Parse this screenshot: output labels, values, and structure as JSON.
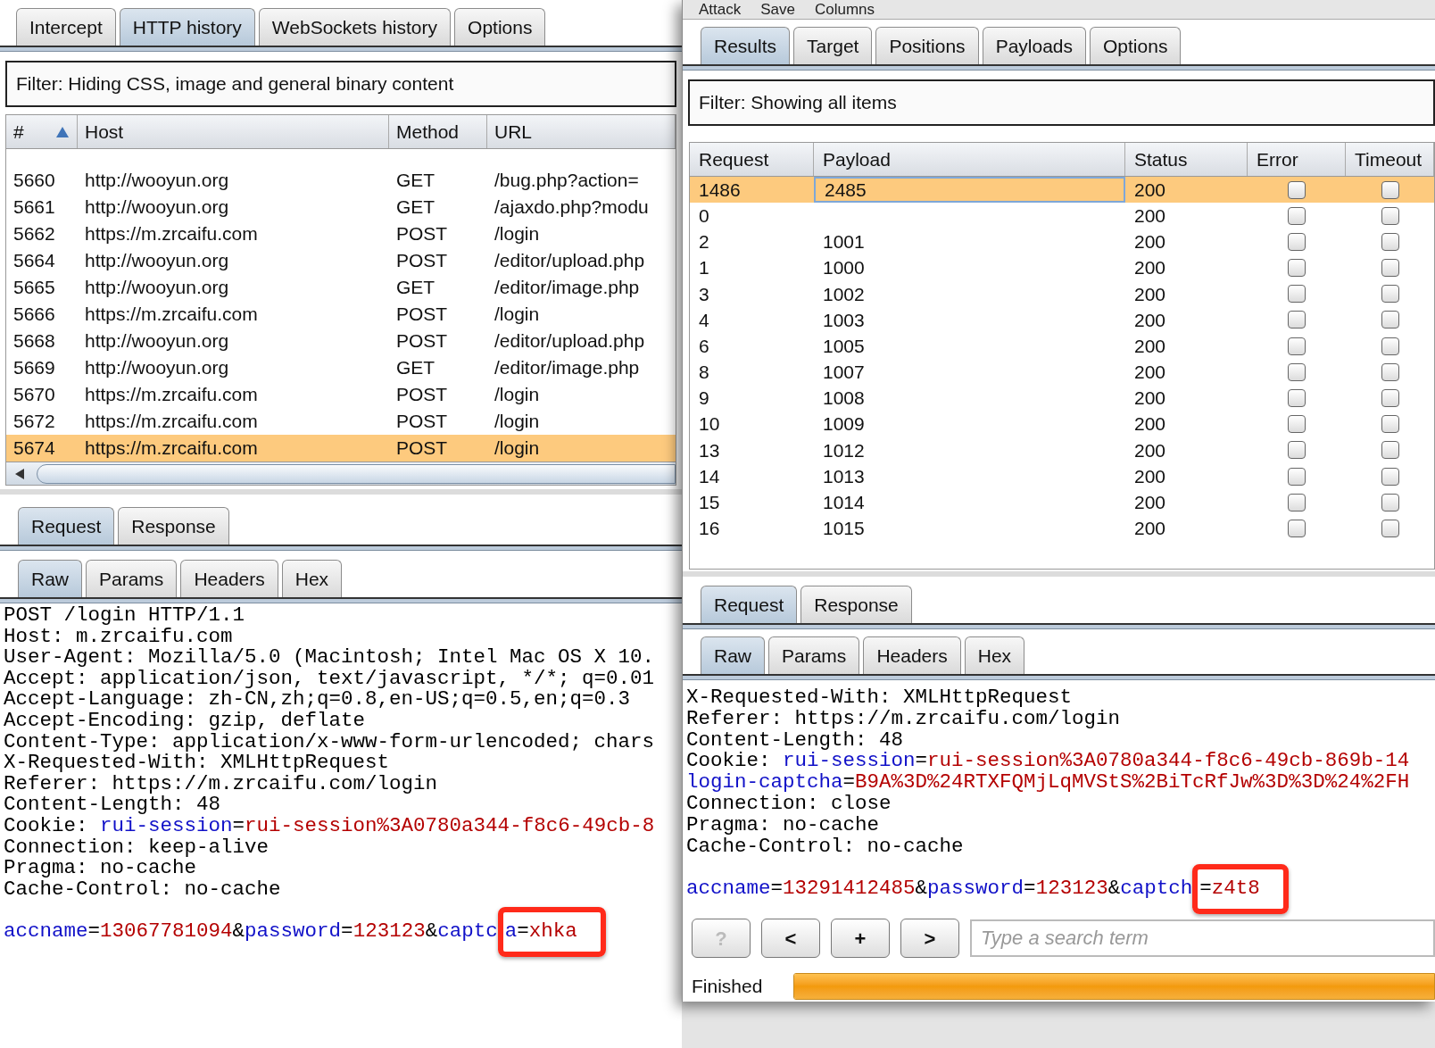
{
  "proxy_window": {
    "tabs": [
      {
        "label": "Intercept",
        "selected": false
      },
      {
        "label": "HTTP history",
        "selected": true
      },
      {
        "label": "WebSockets history",
        "selected": false
      },
      {
        "label": "Options",
        "selected": false
      }
    ],
    "filter": "Filter:  Hiding CSS, image and general binary content",
    "table": {
      "columns": [
        {
          "label": "#",
          "sorted": true
        },
        {
          "label": "Host",
          "sorted": false
        },
        {
          "label": "Method",
          "sorted": false
        },
        {
          "label": "URL",
          "sorted": false
        }
      ],
      "rows": [
        {
          "cells": [
            "5660",
            "http://wooyun.org",
            "GET",
            "/bug.php?action="
          ],
          "selected": false
        },
        {
          "cells": [
            "5661",
            "http://wooyun.org",
            "GET",
            "/ajaxdo.php?modu"
          ],
          "selected": false
        },
        {
          "cells": [
            "5662",
            "https://m.zrcaifu.com",
            "POST",
            "/login"
          ],
          "selected": false
        },
        {
          "cells": [
            "5664",
            "http://wooyun.org",
            "POST",
            "/editor/upload.php"
          ],
          "selected": false
        },
        {
          "cells": [
            "5665",
            "http://wooyun.org",
            "GET",
            "/editor/image.php"
          ],
          "selected": false
        },
        {
          "cells": [
            "5666",
            "https://m.zrcaifu.com",
            "POST",
            "/login"
          ],
          "selected": false
        },
        {
          "cells": [
            "5668",
            "http://wooyun.org",
            "POST",
            "/editor/upload.php"
          ],
          "selected": false
        },
        {
          "cells": [
            "5669",
            "http://wooyun.org",
            "GET",
            "/editor/image.php"
          ],
          "selected": false
        },
        {
          "cells": [
            "5670",
            "https://m.zrcaifu.com",
            "POST",
            "/login"
          ],
          "selected": false
        },
        {
          "cells": [
            "5672",
            "https://m.zrcaifu.com",
            "POST",
            "/login"
          ],
          "selected": false
        },
        {
          "cells": [
            "5674",
            "https://m.zrcaifu.com",
            "POST",
            "/login"
          ],
          "selected": true
        }
      ]
    },
    "message_tabs": [
      {
        "label": "Request",
        "selected": true
      },
      {
        "label": "Response",
        "selected": false
      }
    ],
    "view_tabs": [
      {
        "label": "Raw",
        "selected": true
      },
      {
        "label": "Params",
        "selected": false
      },
      {
        "label": "Headers",
        "selected": false
      },
      {
        "label": "Hex",
        "selected": false
      }
    ],
    "lines": [
      [
        {
          "text": "POST /login HTTP/1.1",
          "kind": "plain"
        }
      ],
      [
        {
          "text": "Host: m.zrcaifu.com",
          "kind": "plain"
        }
      ],
      [
        {
          "text": "User-Agent: Mozilla/5.0 (Macintosh; Intel Mac OS X 10.",
          "kind": "plain"
        }
      ],
      [
        {
          "text": "Accept: application/json, text/javascript, */*; q=0.01",
          "kind": "plain"
        }
      ],
      [
        {
          "text": "Accept-Language: zh-CN,zh;q=0.8,en-US;q=0.5,en;q=0.3",
          "kind": "plain"
        }
      ],
      [
        {
          "text": "Accept-Encoding: gzip, deflate",
          "kind": "plain"
        }
      ],
      [
        {
          "text": "Content-Type: application/x-www-form-urlencoded; chars",
          "kind": "plain"
        }
      ],
      [
        {
          "text": "X-Requested-With: XMLHttpRequest",
          "kind": "plain"
        }
      ],
      [
        {
          "text": "Referer: https://m.zrcaifu.com/login",
          "kind": "plain"
        }
      ],
      [
        {
          "text": "Content-Length: 48",
          "kind": "plain"
        }
      ],
      [
        {
          "text": "Cookie: ",
          "kind": "plain"
        },
        {
          "text": "rui-session",
          "kind": "name"
        },
        {
          "text": "=",
          "kind": "plain"
        },
        {
          "text": "rui-session%3A0780a344-f8c6-49cb-8",
          "kind": "value"
        }
      ],
      [
        {
          "text": "Connection: keep-alive",
          "kind": "plain"
        }
      ],
      [
        {
          "text": "Pragma: no-cache",
          "kind": "plain"
        }
      ],
      [
        {
          "text": "Cache-Control: no-cache",
          "kind": "plain"
        }
      ]
    ],
    "body": [
      {
        "text": "accname",
        "kind": "name"
      },
      {
        "text": "=",
        "kind": "plain"
      },
      {
        "text": "13067781094",
        "kind": "value"
      },
      {
        "text": "&",
        "kind": "plain"
      },
      {
        "text": "password",
        "kind": "name"
      },
      {
        "text": "=",
        "kind": "plain"
      },
      {
        "text": "123123",
        "kind": "value"
      },
      {
        "text": "&",
        "kind": "plain"
      },
      {
        "text": "captc",
        "kind": "name"
      },
      {
        "kind": "boxed",
        "parts": [
          {
            "text": "a",
            "kind": "name"
          },
          {
            "text": "=",
            "kind": "plain"
          },
          {
            "text": "xhka",
            "kind": "value"
          }
        ]
      }
    ]
  },
  "intruder_window": {
    "menu": [
      "Attack",
      "Save",
      "Columns"
    ],
    "tabs": [
      {
        "label": "Results",
        "selected": true
      },
      {
        "label": "Target",
        "selected": false
      },
      {
        "label": "Positions",
        "selected": false
      },
      {
        "label": "Payloads",
        "selected": false
      },
      {
        "label": "Options",
        "selected": false
      }
    ],
    "filter": "Filter:  Showing all items",
    "table": {
      "columns": [
        "Request",
        "Payload",
        "Status",
        "Error",
        "Timeout"
      ],
      "rows": [
        {
          "request": "1486",
          "payload": "2485",
          "status": "200",
          "error": false,
          "timeout": false,
          "selected": true
        },
        {
          "request": "0",
          "status": "200",
          "error": false,
          "timeout": false,
          "selected": false
        },
        {
          "request": "2",
          "payload": "1001",
          "status": "200",
          "error": false,
          "timeout": false,
          "selected": false
        },
        {
          "request": "1",
          "payload": "1000",
          "status": "200",
          "error": false,
          "timeout": false,
          "selected": false
        },
        {
          "request": "3",
          "payload": "1002",
          "status": "200",
          "error": false,
          "timeout": false,
          "selected": false
        },
        {
          "request": "4",
          "payload": "1003",
          "status": "200",
          "error": false,
          "timeout": false,
          "selected": false
        },
        {
          "request": "6",
          "payload": "1005",
          "status": "200",
          "error": false,
          "timeout": false,
          "selected": false
        },
        {
          "request": "8",
          "payload": "1007",
          "status": "200",
          "error": false,
          "timeout": false,
          "selected": false
        },
        {
          "request": "9",
          "payload": "1008",
          "status": "200",
          "error": false,
          "timeout": false,
          "selected": false
        },
        {
          "request": "10",
          "payload": "1009",
          "status": "200",
          "error": false,
          "timeout": false,
          "selected": false
        },
        {
          "request": "13",
          "payload": "1012",
          "status": "200",
          "error": false,
          "timeout": false,
          "selected": false
        },
        {
          "request": "14",
          "payload": "1013",
          "status": "200",
          "error": false,
          "timeout": false,
          "selected": false
        },
        {
          "request": "15",
          "payload": "1014",
          "status": "200",
          "error": false,
          "timeout": false,
          "selected": false
        },
        {
          "request": "16",
          "payload": "1015",
          "status": "200",
          "error": false,
          "timeout": false,
          "selected": false
        }
      ]
    },
    "message_tabs": [
      {
        "label": "Request",
        "selected": true
      },
      {
        "label": "Response",
        "selected": false
      }
    ],
    "view_tabs": [
      {
        "label": "Raw",
        "selected": true
      },
      {
        "label": "Params",
        "selected": false
      },
      {
        "label": "Headers",
        "selected": false
      },
      {
        "label": "Hex",
        "selected": false
      }
    ],
    "lines": [
      [
        {
          "text": "X-Requested-With: XMLHttpRequest",
          "kind": "plain"
        }
      ],
      [
        {
          "text": "Referer: https://m.zrcaifu.com/login",
          "kind": "plain"
        }
      ],
      [
        {
          "text": "Content-Length: 48",
          "kind": "plain"
        }
      ],
      [
        {
          "text": "Cookie: ",
          "kind": "plain"
        },
        {
          "text": "rui-session",
          "kind": "name"
        },
        {
          "text": "=",
          "kind": "plain"
        },
        {
          "text": "rui-session%3A0780a344-f8c6-49cb-869b-14",
          "kind": "value"
        }
      ],
      [
        {
          "text": "login-captcha",
          "kind": "name"
        },
        {
          "text": "=",
          "kind": "plain"
        },
        {
          "text": "B9A%3D%24RTXFQMjLqMVStS%2BiTcRfJw%3D%3D%24%2FH",
          "kind": "value"
        }
      ],
      [
        {
          "text": "Connection: close",
          "kind": "plain"
        }
      ],
      [
        {
          "text": "Pragma: no-cache",
          "kind": "plain"
        }
      ],
      [
        {
          "text": "Cache-Control: no-cache",
          "kind": "plain"
        }
      ]
    ],
    "body": [
      {
        "text": "accname",
        "kind": "name"
      },
      {
        "text": "=",
        "kind": "plain"
      },
      {
        "text": "13291412485",
        "kind": "value"
      },
      {
        "text": "&",
        "kind": "plain"
      },
      {
        "text": "password",
        "kind": "name"
      },
      {
        "text": "=",
        "kind": "plain"
      },
      {
        "text": "123123",
        "kind": "value"
      },
      {
        "text": "&",
        "kind": "plain"
      },
      {
        "text": "captch",
        "kind": "name"
      },
      {
        "kind": "boxed",
        "parts": [
          {
            "text": "=",
            "kind": "plain"
          },
          {
            "text": "z4t8",
            "kind": "value"
          }
        ]
      }
    ],
    "search_buttons": [
      {
        "label": "?",
        "disabled": true
      },
      {
        "label": "<",
        "disabled": false
      },
      {
        "label": "+",
        "disabled": false
      },
      {
        "label": ">",
        "disabled": false
      }
    ],
    "search": {
      "placeholder": "Type a search term"
    },
    "status": {
      "label": "Finished",
      "level": 1
    }
  }
}
